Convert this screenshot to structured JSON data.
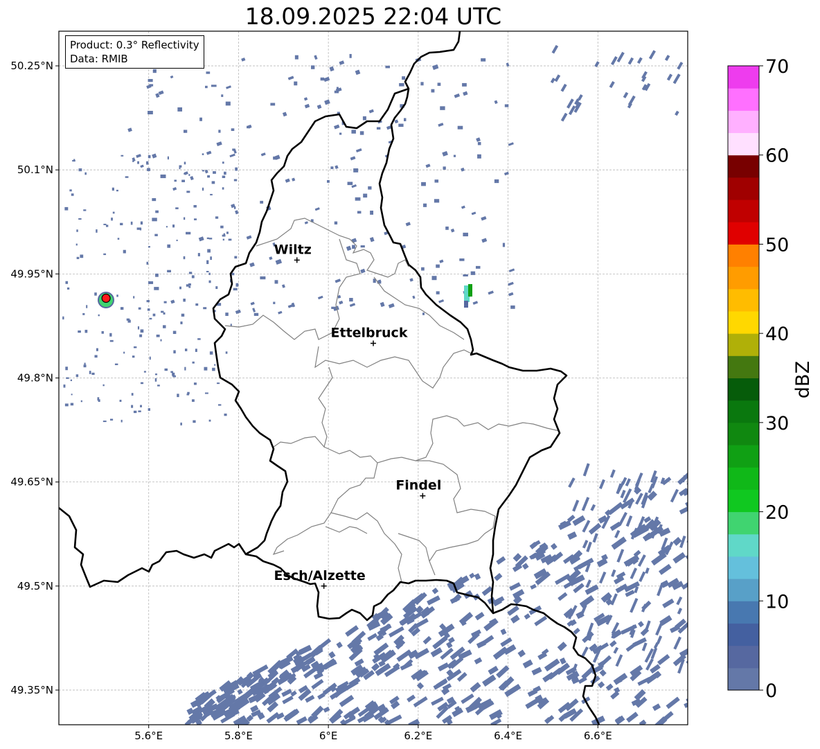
{
  "title": "18.09.2025 22:04 UTC",
  "info": {
    "product": "Product: 0.3° Reflectivity",
    "source": "Data: RMIB"
  },
  "map": {
    "lon_range": [
      5.4,
      6.8
    ],
    "lat_range": [
      49.3,
      50.3
    ],
    "lon_ticks": [
      {
        "value": 5.6,
        "label": "5.6°E"
      },
      {
        "value": 5.8,
        "label": "5.8°E"
      },
      {
        "value": 6.0,
        "label": "6°E"
      },
      {
        "value": 6.2,
        "label": "6.2°E"
      },
      {
        "value": 6.4,
        "label": "6.4°E"
      },
      {
        "value": 6.6,
        "label": "6.6°E"
      }
    ],
    "lat_ticks": [
      {
        "value": 50.25,
        "label": "50.25°N"
      },
      {
        "value": 50.1,
        "label": "50.1°N"
      },
      {
        "value": 49.95,
        "label": "49.95°N"
      },
      {
        "value": 49.8,
        "label": "49.8°N"
      },
      {
        "value": 49.65,
        "label": "49.65°N"
      },
      {
        "value": 49.5,
        "label": "49.5°N"
      },
      {
        "value": 49.35,
        "label": "49.35°N"
      }
    ],
    "grid": true,
    "cities": [
      {
        "name": "Wiltz",
        "lon": 5.93,
        "lat": 49.97
      },
      {
        "name": "Ettelbruck",
        "lon": 6.1,
        "lat": 49.85
      },
      {
        "name": "Findel",
        "lon": 6.21,
        "lat": 49.63
      },
      {
        "name": "Esch/Alzette",
        "lon": 5.99,
        "lat": 49.5
      }
    ],
    "radar_site": {
      "lon": 5.505,
      "lat": 49.915,
      "color": "#ff1a1a"
    },
    "border_color": "#000000",
    "canton_color": "#808080"
  },
  "colorbar": {
    "label": "dBZ",
    "min": 0,
    "max": 70,
    "step": 2.5,
    "ticks": [
      0,
      10,
      20,
      30,
      40,
      50,
      60,
      70
    ],
    "colors": [
      "#6478a8",
      "#5668a0",
      "#4460a0",
      "#4878b0",
      "#58a0c8",
      "#64c0dc",
      "#60d8c8",
      "#40d470",
      "#10c820",
      "#10b818",
      "#10a014",
      "#108810",
      "#0a780e",
      "#065c0a",
      "#447810",
      "#b0b008",
      "#ffd800",
      "#ffbc00",
      "#ff9c00",
      "#ff8000",
      "#e00000",
      "#c00000",
      "#a00000",
      "#780000",
      "#ffe0ff",
      "#ffb0ff",
      "#ff70ff",
      "#ee3cee"
    ]
  }
}
